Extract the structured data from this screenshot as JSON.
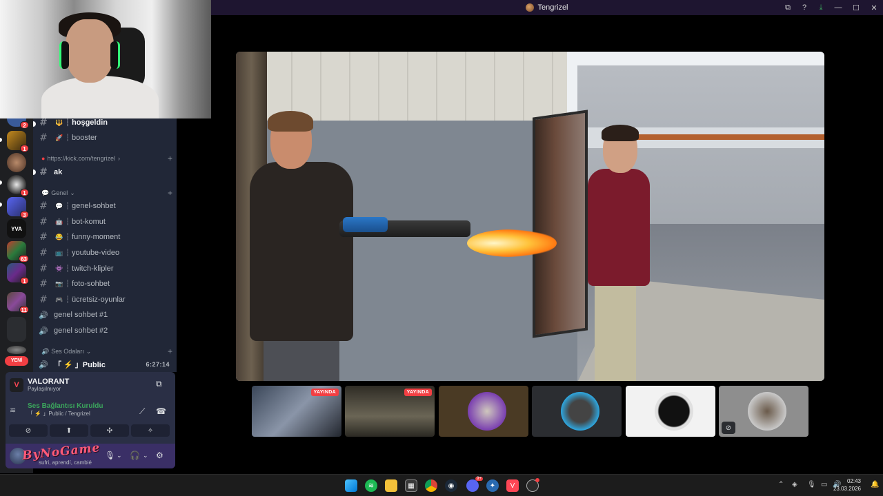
{
  "window": {
    "title": "Tengrizel",
    "controls": {
      "minimize": "—",
      "maximize": "☐",
      "close": "✕"
    }
  },
  "rail": {
    "badges": [
      "2",
      "1",
      "1",
      "3",
      "63",
      "1",
      "11"
    ],
    "new_label": "YENİ"
  },
  "channels": {
    "items": [
      {
        "type": "text",
        "emoji": "🔱",
        "name": "hoşgeldin",
        "bold": true
      },
      {
        "type": "text",
        "emoji": "🚀",
        "name": "booster"
      }
    ],
    "kick_category": "https://kick.com/tengrizel",
    "ak_channel": "ak",
    "genel_category": "Genel",
    "genel_items": [
      {
        "emoji": "💬",
        "name": "genel-sohbet"
      },
      {
        "emoji": "🤖",
        "name": "bot-komut"
      },
      {
        "emoji": "😂",
        "name": "funny-moment"
      },
      {
        "emoji": "📺",
        "name": "youtube-video"
      },
      {
        "emoji": "👾",
        "name": "twitch-klipler"
      },
      {
        "emoji": "📷",
        "name": "foto-sohbet"
      },
      {
        "emoji": "🎮",
        "name": "ücretsiz-oyunlar"
      }
    ],
    "voice_items": [
      "genel sohbet #1",
      "genel sohbet #2"
    ],
    "ses_category": "Ses Odaları",
    "public_channel": "「 ⚡ 」Public",
    "public_time": "6:27:14"
  },
  "activity": {
    "game": "VALORANT",
    "game_sub": "Paylaşılmıyor",
    "conn_title": "Ses Bağlantısı Kuruldu",
    "conn_sub": "「 ⚡ 」Public / Tengrizel"
  },
  "user": {
    "name": "ByNoGame",
    "status": "sufri, aprendí, cambié"
  },
  "thumbs": {
    "live_label": "YAYINDA"
  },
  "taskbar": {
    "discord_badge": "9+",
    "time": "02:43",
    "date": "23.03.2026"
  }
}
